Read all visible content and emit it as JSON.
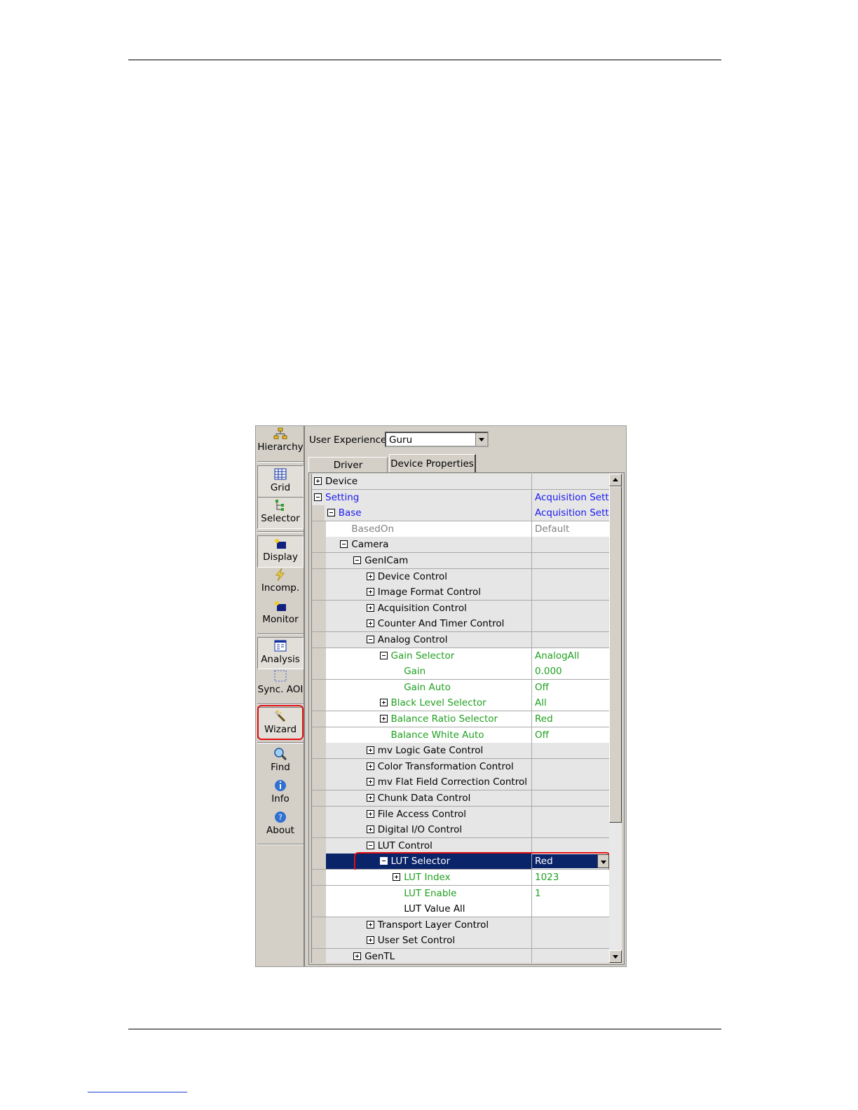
{
  "toolbar": {
    "items": [
      {
        "label": "Hierarchy",
        "icon": "hierarchy-icon"
      },
      {
        "label": "Grid",
        "icon": "grid-icon"
      },
      {
        "label": "Selector",
        "icon": "selector-icon"
      },
      {
        "label": "Display",
        "icon": "display-icon"
      },
      {
        "label": "Incomp.",
        "icon": "lightning-icon"
      },
      {
        "label": "Monitor",
        "icon": "monitor-icon"
      },
      {
        "label": "Analysis",
        "icon": "analysis-icon"
      },
      {
        "label": "Sync. AOI",
        "icon": "dotted-rect-icon"
      },
      {
        "label": "Wizard",
        "icon": "wand-icon"
      },
      {
        "label": "Find",
        "icon": "magnifier-icon"
      },
      {
        "label": "Info",
        "icon": "info-icon"
      },
      {
        "label": "About",
        "icon": "help-icon"
      }
    ]
  },
  "header": {
    "user_experience_label": "User Experience:",
    "user_experience_value": "Guru"
  },
  "tabs": [
    {
      "label": "Driver Properties"
    },
    {
      "label": "Device Properties"
    }
  ],
  "grid": {
    "rows": [
      {
        "name": "Device",
        "value": ""
      },
      {
        "name": "Setting",
        "value": "Acquisition Setting"
      },
      {
        "name": "Base",
        "value": "Acquisition Setting"
      },
      {
        "name": "BasedOn",
        "value": "Default"
      },
      {
        "name": "Camera",
        "value": ""
      },
      {
        "name": "GenICam",
        "value": ""
      },
      {
        "name": "Device Control",
        "value": ""
      },
      {
        "name": "Image Format Control",
        "value": ""
      },
      {
        "name": "Acquisition Control",
        "value": ""
      },
      {
        "name": "Counter And Timer Control",
        "value": ""
      },
      {
        "name": "Analog Control",
        "value": ""
      },
      {
        "name": "Gain Selector",
        "value": "AnalogAll"
      },
      {
        "name": "Gain",
        "value": "0.000"
      },
      {
        "name": "Gain Auto",
        "value": "Off"
      },
      {
        "name": "Black Level Selector",
        "value": "All"
      },
      {
        "name": "Balance Ratio Selector",
        "value": "Red"
      },
      {
        "name": "Balance White Auto",
        "value": "Off"
      },
      {
        "name": "mv Logic Gate Control",
        "value": ""
      },
      {
        "name": "Color Transformation Control",
        "value": ""
      },
      {
        "name": "mv Flat Field Correction Control",
        "value": ""
      },
      {
        "name": "Chunk Data Control",
        "value": ""
      },
      {
        "name": "File Access Control",
        "value": ""
      },
      {
        "name": "Digital I/O Control",
        "value": ""
      },
      {
        "name": "LUT Control",
        "value": ""
      },
      {
        "name": "LUT Selector",
        "value": "Red"
      },
      {
        "name": "LUT Index",
        "value": "1023"
      },
      {
        "name": "LUT Enable",
        "value": "1"
      },
      {
        "name": "LUT Value All",
        "value": ""
      },
      {
        "name": "Transport Layer Control",
        "value": ""
      },
      {
        "name": "User Set Control",
        "value": ""
      },
      {
        "name": "GenTL",
        "value": ""
      }
    ]
  },
  "colors": {
    "selection": "#0a246a",
    "highlight_box": "#e01010",
    "blue_text": "#1a1af0",
    "green_text": "#20a020"
  }
}
